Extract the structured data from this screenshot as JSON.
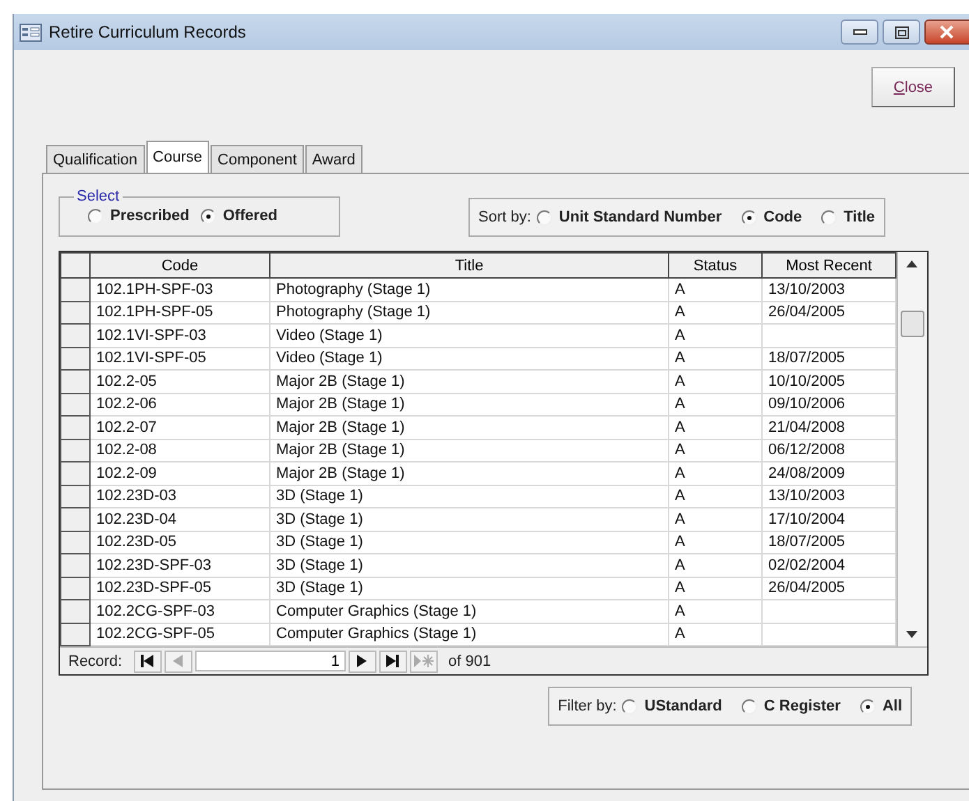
{
  "window": {
    "title": "Retire Curriculum Records"
  },
  "close_button": {
    "label": "Close"
  },
  "tabs": [
    {
      "label": "Qualification",
      "selected": false
    },
    {
      "label": "Course",
      "selected": true
    },
    {
      "label": "Component",
      "selected": false
    },
    {
      "label": "Award",
      "selected": false
    }
  ],
  "select_group": {
    "legend": "Select",
    "options": [
      {
        "label": "Prescribed",
        "selected": false
      },
      {
        "label": "Offered",
        "selected": true
      }
    ]
  },
  "sort_by": {
    "label": "Sort by:",
    "options": [
      {
        "label": "Unit Standard Number",
        "selected": false
      },
      {
        "label": "Code",
        "selected": true
      },
      {
        "label": "Title",
        "selected": false
      }
    ]
  },
  "table": {
    "columns": [
      "Code",
      "Title",
      "Status",
      "Most Recent"
    ],
    "rows": [
      {
        "code": "102.1PH-SPF-03",
        "title": "Photography (Stage 1)",
        "status": "A",
        "most_recent": "13/10/2003"
      },
      {
        "code": "102.1PH-SPF-05",
        "title": "Photography (Stage 1)",
        "status": "A",
        "most_recent": "26/04/2005"
      },
      {
        "code": "102.1VI-SPF-03",
        "title": "Video (Stage 1)",
        "status": "A",
        "most_recent": ""
      },
      {
        "code": "102.1VI-SPF-05",
        "title": "Video (Stage 1)",
        "status": "A",
        "most_recent": "18/07/2005"
      },
      {
        "code": "102.2-05",
        "title": "Major 2B (Stage 1)",
        "status": "A",
        "most_recent": "10/10/2005"
      },
      {
        "code": "102.2-06",
        "title": "Major 2B (Stage 1)",
        "status": "A",
        "most_recent": "09/10/2006"
      },
      {
        "code": "102.2-07",
        "title": "Major 2B (Stage 1)",
        "status": "A",
        "most_recent": "21/04/2008"
      },
      {
        "code": "102.2-08",
        "title": "Major 2B (Stage 1)",
        "status": "A",
        "most_recent": "06/12/2008"
      },
      {
        "code": "102.2-09",
        "title": "Major 2B (Stage 1)",
        "status": "A",
        "most_recent": "24/08/2009"
      },
      {
        "code": "102.23D-03",
        "title": "3D (Stage 1)",
        "status": "A",
        "most_recent": "13/10/2003"
      },
      {
        "code": "102.23D-04",
        "title": "3D (Stage 1)",
        "status": "A",
        "most_recent": "17/10/2004"
      },
      {
        "code": "102.23D-05",
        "title": "3D (Stage 1)",
        "status": "A",
        "most_recent": "18/07/2005"
      },
      {
        "code": "102.23D-SPF-03",
        "title": "3D (Stage 1)",
        "status": "A",
        "most_recent": "02/02/2004"
      },
      {
        "code": "102.23D-SPF-05",
        "title": "3D (Stage 1)",
        "status": "A",
        "most_recent": "26/04/2005"
      },
      {
        "code": "102.2CG-SPF-03",
        "title": "Computer Graphics (Stage 1)",
        "status": "A",
        "most_recent": ""
      },
      {
        "code": "102.2CG-SPF-05",
        "title": "Computer Graphics (Stage 1)",
        "status": "A",
        "most_recent": ""
      }
    ]
  },
  "record_nav": {
    "label": "Record:",
    "current": "1",
    "total": "of 901"
  },
  "filter_by": {
    "label": "Filter by:",
    "options": [
      {
        "label": "UStandard",
        "selected": false
      },
      {
        "label": "C Register",
        "selected": false
      },
      {
        "label": "All",
        "selected": true
      }
    ]
  }
}
